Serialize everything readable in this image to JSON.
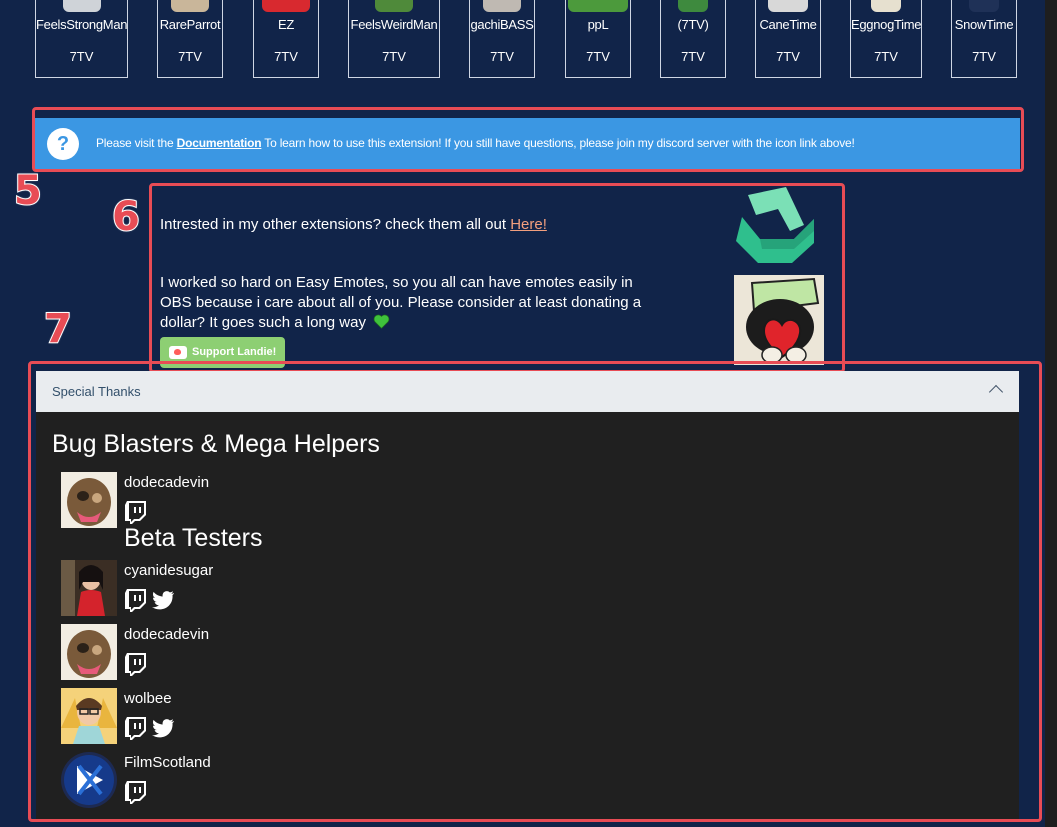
{
  "emotes": [
    {
      "name": "FeelsStrongMan",
      "provider": "7TV"
    },
    {
      "name": "RareParrot",
      "provider": "7TV"
    },
    {
      "name": "EZ",
      "provider": "7TV"
    },
    {
      "name": "FeelsWeirdMan",
      "provider": "7TV"
    },
    {
      "name": "gachiBASS",
      "provider": "7TV"
    },
    {
      "name": "ppL",
      "provider": "7TV"
    },
    {
      "name": "(7TV)",
      "provider": "7TV"
    },
    {
      "name": "CaneTime",
      "provider": "7TV"
    },
    {
      "name": "EggnogTime",
      "provider": "7TV"
    },
    {
      "name": "SnowTime",
      "provider": "7TV"
    }
  ],
  "annotations": {
    "n5": "5",
    "n6": "6",
    "n7": "7"
  },
  "info": {
    "icon": "question-icon",
    "prefix": "Please visit the ",
    "link": "Documentation",
    "suffix": " To learn how to use this extension! If you still have questions, please join my discord server with the icon link above!"
  },
  "promo": {
    "line1_prefix": "Intrested in my other extensions? check them all out ",
    "line1_link": "Here!",
    "line2": "I worked so hard on Easy Emotes, so you all can have emotes easily in OBS because i care about all of you. Please consider at least donating a dollar? It goes such a long way",
    "heart_icon": "green-heart-icon",
    "support_button": "Support Landie!"
  },
  "special_thanks": {
    "header": "Special Thanks",
    "groups": [
      {
        "title": "Bug Blasters & Mega Helpers",
        "members": [
          {
            "name": "dodecadevin",
            "socials": [
              "twitch"
            ]
          }
        ]
      },
      {
        "title": "Beta Testers",
        "members": [
          {
            "name": "cyanidesugar",
            "socials": [
              "twitch",
              "twitter"
            ]
          },
          {
            "name": "dodecadevin",
            "socials": [
              "twitch"
            ]
          },
          {
            "name": "wolbee",
            "socials": [
              "twitch",
              "twitter"
            ]
          },
          {
            "name": "FilmScotland",
            "socials": [
              "twitch"
            ]
          }
        ]
      }
    ]
  },
  "colors": {
    "page_bg": "#112449",
    "banner": "#3b97e3",
    "annotation": "#e84c55",
    "support_button": "#8dcf73",
    "link_orange": "#f29f7e",
    "panel_bg": "#202020"
  }
}
